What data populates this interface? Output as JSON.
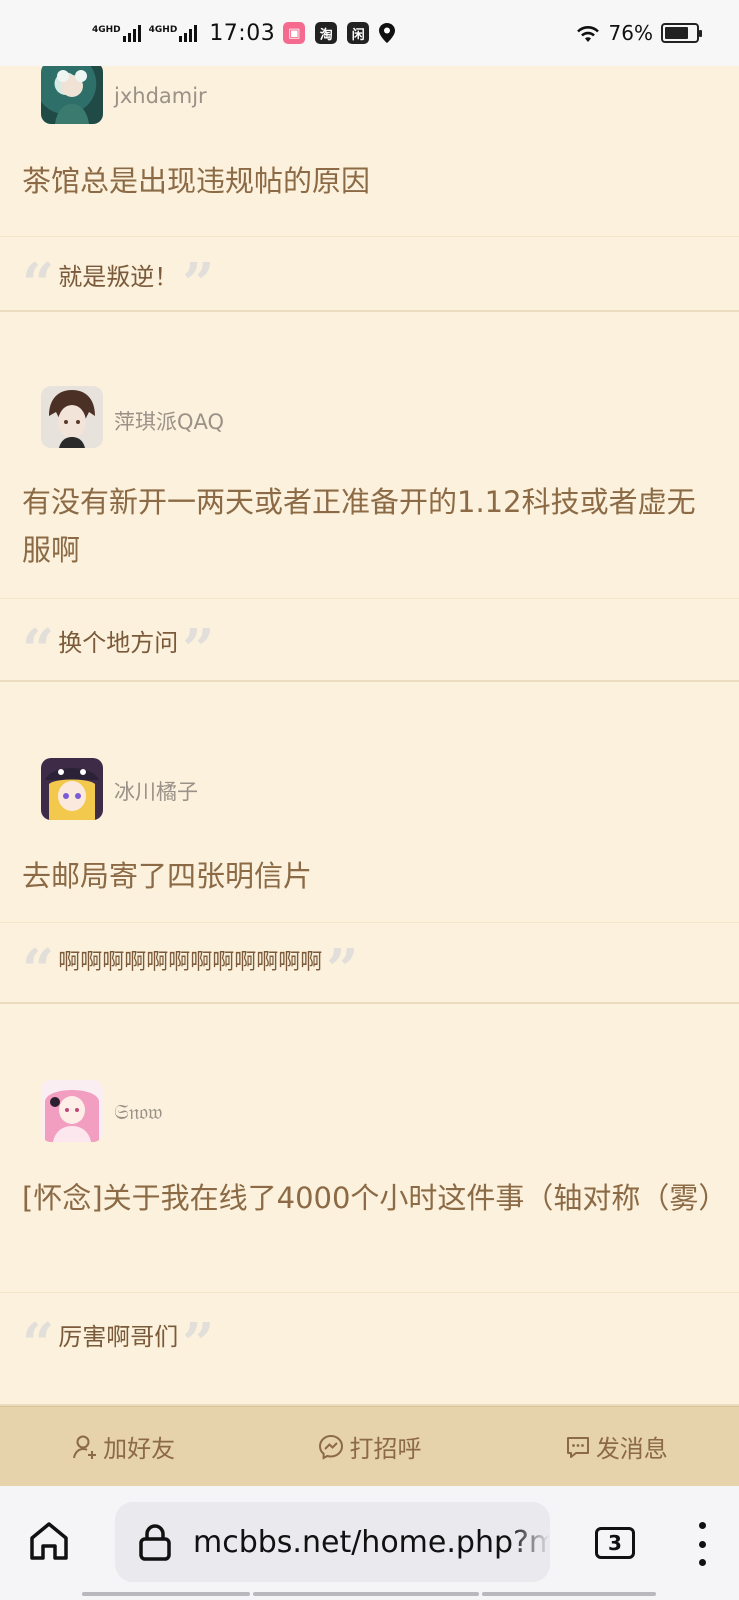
{
  "status_bar": {
    "signal1_label": "4GHD",
    "signal2_label": "4GHD",
    "time": "17:03",
    "battery_percent": "76%",
    "battery_level": 0.76,
    "app_icons": [
      "bilibili-icon",
      "taobao-icon",
      "xianyu-icon",
      "location-pin-icon"
    ]
  },
  "posts": [
    {
      "author": "jxhdamjr",
      "title": "茶馆总是出现违规帖的原因",
      "reply": "就是叛逆！"
    },
    {
      "author": "萍琪派QAQ",
      "title": "有没有新开一两天或者正准备开的1.12科技或者虚无服啊",
      "reply": "换个地方问"
    },
    {
      "author": "冰川橘子",
      "title": "去邮局寄了四张明信片",
      "reply": "啊啊啊啊啊啊啊啊啊啊啊啊"
    },
    {
      "author": "𝔖𝔫𝔬𝔴",
      "title": "[怀念]关于我在线了4000个小时这件事（轴对称（雾）",
      "reply": "厉害啊哥们"
    }
  ],
  "actions": {
    "add_friend": "加好友",
    "greet": "打招呼",
    "message": "发消息"
  },
  "browser": {
    "url": "mcbbs.net/home.php?m",
    "tab_count": "3"
  },
  "colors": {
    "page_bg": "#fbf1dc",
    "action_bar_bg": "#e6d2ab",
    "text_brown": "#8b6a45"
  }
}
